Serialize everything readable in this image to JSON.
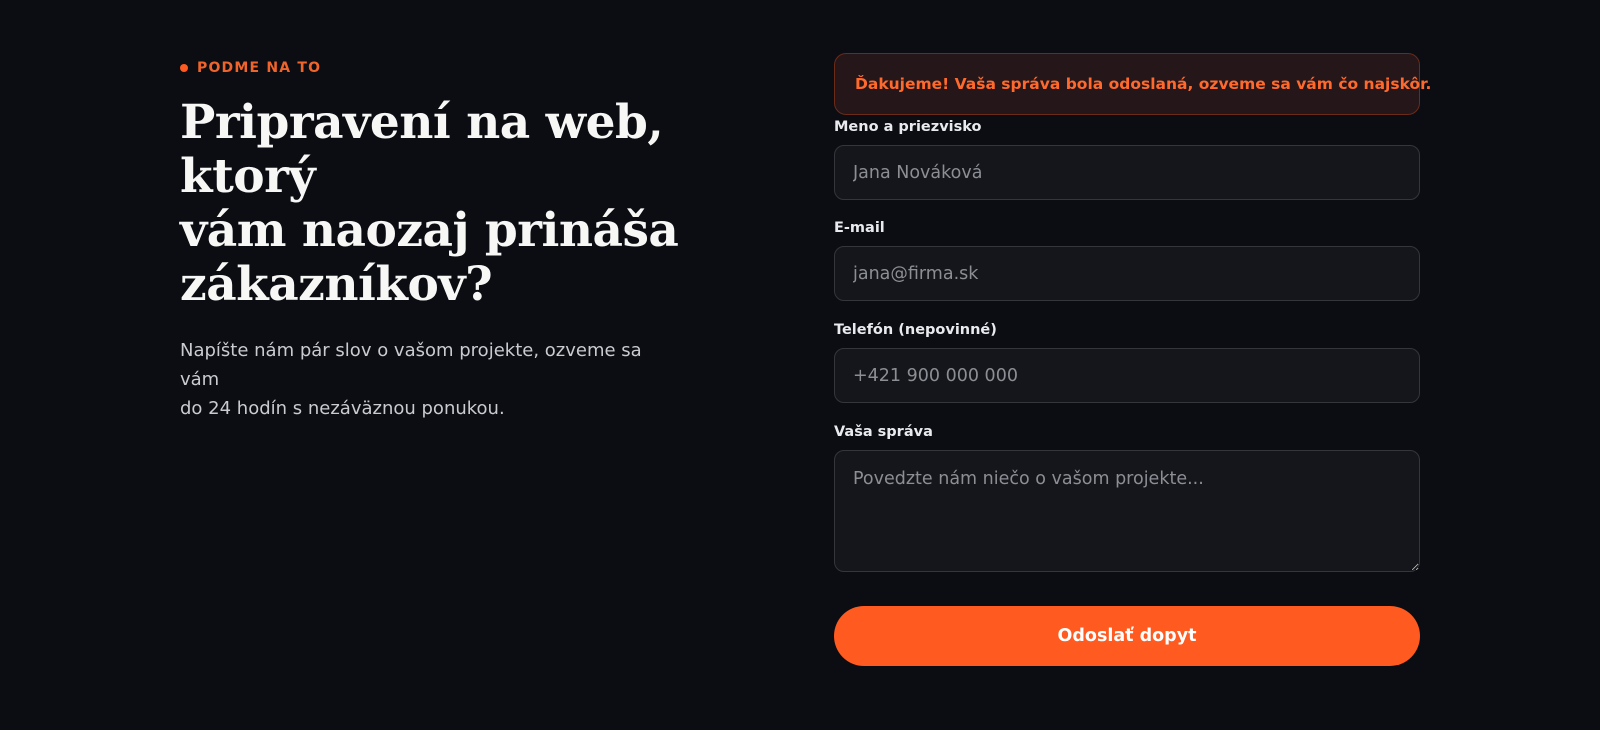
{
  "hero": {
    "eyebrow": "PODME NA TO",
    "headline_lines": [
      "Pripravení na web, ktorý",
      "vám naozaj prináša",
      "zákazníkov?"
    ],
    "lead_lines": [
      "Napíšte nám pár slov o vašom projekte, ozveme sa vám",
      "do 24 hodín s nezáväznou ponukou."
    ]
  },
  "form": {
    "success_message": "Ďakujeme! Vaša správa bola odoslaná, ozveme sa vám čo najskôr.",
    "name": {
      "label": "Meno a priezvisko",
      "placeholder": "Jana Nováková",
      "value": ""
    },
    "email": {
      "label": "E-mail",
      "placeholder": "jana@firma.sk",
      "value": ""
    },
    "phone": {
      "label": "Telefón (nepovinné)",
      "placeholder": "+421 900 000 000",
      "value": ""
    },
    "message": {
      "label": "Vaša správa",
      "placeholder": "Povedzte nám niečo o vašom projekte...",
      "value": ""
    },
    "submit_label": "Odoslať dopyt"
  },
  "colors": {
    "background": "#0b0d12",
    "accent": "#ff5a1f",
    "alert_bg": "#25161a",
    "alert_border": "#6b2b18",
    "input_bg": "#15161b",
    "input_border": "#34363d"
  },
  "icons": {
    "eyebrow": "orange-dot-icon"
  }
}
